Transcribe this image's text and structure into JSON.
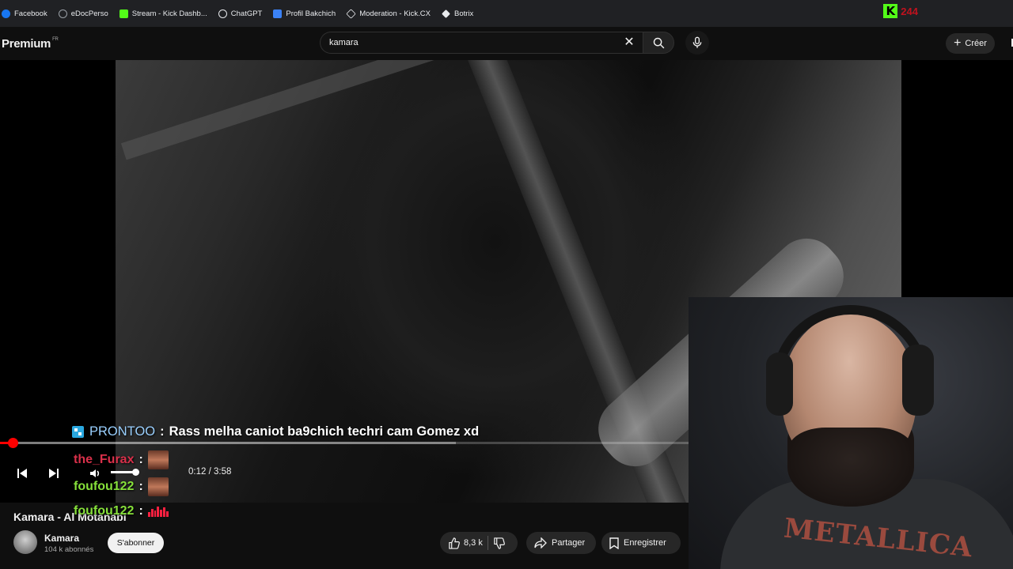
{
  "bookmarks": [
    {
      "label": "Facebook",
      "color": "#1877f2"
    },
    {
      "label": "eDocPerso",
      "color": "#9aa0a6"
    },
    {
      "label": "Stream - Kick Dashb...",
      "color": "#53fc18"
    },
    {
      "label": "ChatGPT",
      "color": "#9aa0a6"
    },
    {
      "label": "Profil Bakchich",
      "color": "#3b82f6"
    },
    {
      "label": "Moderation - Kick.CX",
      "color": "#9aa0a6"
    },
    {
      "label": "Botrix",
      "color": "#9aa0a6"
    }
  ],
  "kick_overlay": {
    "logo": "K",
    "count": "244",
    "color": "#53fc18"
  },
  "header": {
    "logo_text": "Premium",
    "logo_region": "FR",
    "search_value": "kamara",
    "create_label": "Créer"
  },
  "player": {
    "progress_fraction": 0.05,
    "current_time": "0:12",
    "duration": "3:58",
    "time_separator": "/",
    "volume_fraction": 0.85
  },
  "chat": {
    "highlight": {
      "user": "PRONTOO",
      "separator": ":",
      "message": "Rass melha caniot ba9chich techri cam Gomez xd"
    },
    "lines": [
      {
        "user": "the_Furax",
        "separator": ":",
        "color": "#d9304a"
      },
      {
        "user": "foufou122",
        "separator": ":",
        "color": "#86e03a"
      },
      {
        "user": "foufou122",
        "separator": ":",
        "color": "#86e03a"
      }
    ]
  },
  "webcam": {
    "shirt_text": "METALLICA"
  },
  "video_meta": {
    "title": "Kamara - Al Motanabi",
    "channel_name": "Kamara",
    "subscribers": "104 k abonnés",
    "subscribe_label": "S'abonner",
    "likes": "8,3 k",
    "share_label": "Partager",
    "save_label": "Enregistrer"
  }
}
